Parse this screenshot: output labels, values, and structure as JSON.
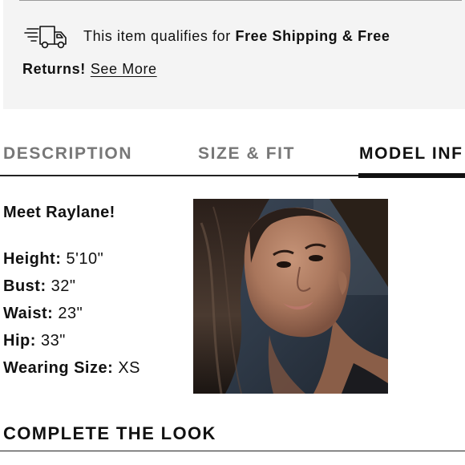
{
  "shipping": {
    "icon": "fast-delivery-truck-icon",
    "text_prefix": "This item qualifies for ",
    "text_bold": "Free Shipping & Free",
    "text_bold2": "Returns!",
    "link_label": "See More"
  },
  "tabs": [
    {
      "label": "DESCRIPTION",
      "active": false
    },
    {
      "label": "SIZE & FIT",
      "active": false
    },
    {
      "label": "MODEL INF",
      "active": true
    }
  ],
  "model": {
    "heading": "Meet Raylane!",
    "stats": [
      {
        "label": "Height:",
        "value": "5'10\""
      },
      {
        "label": "Bust:",
        "value": "32\""
      },
      {
        "label": "Waist:",
        "value": "23\""
      },
      {
        "label": "Hip:",
        "value": "33\""
      },
      {
        "label": "Wearing Size:",
        "value": "XS"
      }
    ]
  },
  "complete_the_look": {
    "heading": "COMPLETE THE LOOK"
  },
  "colors": {
    "banner_bg": "#f4f4f4",
    "text": "#111111",
    "inactive_tab": "#777777"
  }
}
